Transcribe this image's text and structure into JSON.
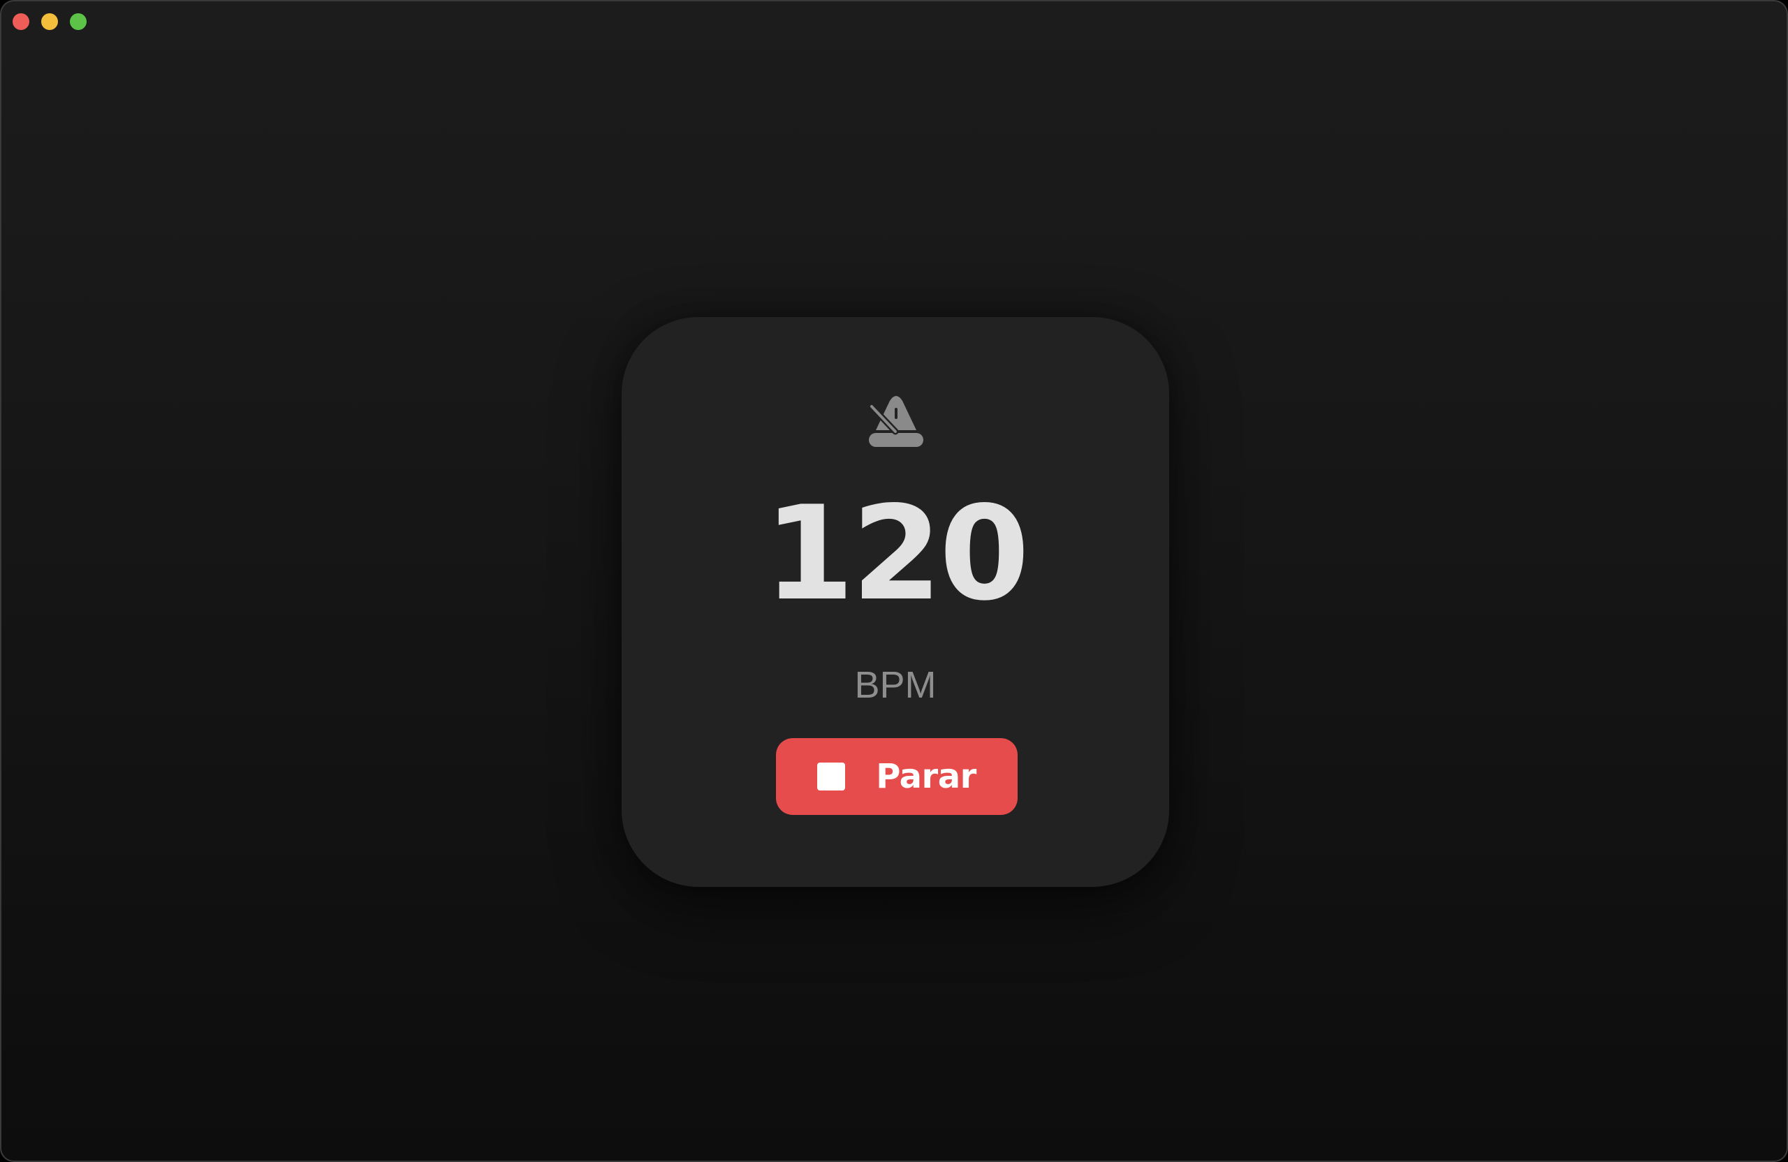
{
  "window": {
    "controls": [
      "close",
      "minimize",
      "zoom"
    ]
  },
  "metronome": {
    "icon": "metronome-icon",
    "bpm": "120",
    "unit": "BPM",
    "stop_label": "Parar",
    "stop_icon": "stop-square-icon",
    "accent_color": "#e74c4c"
  }
}
